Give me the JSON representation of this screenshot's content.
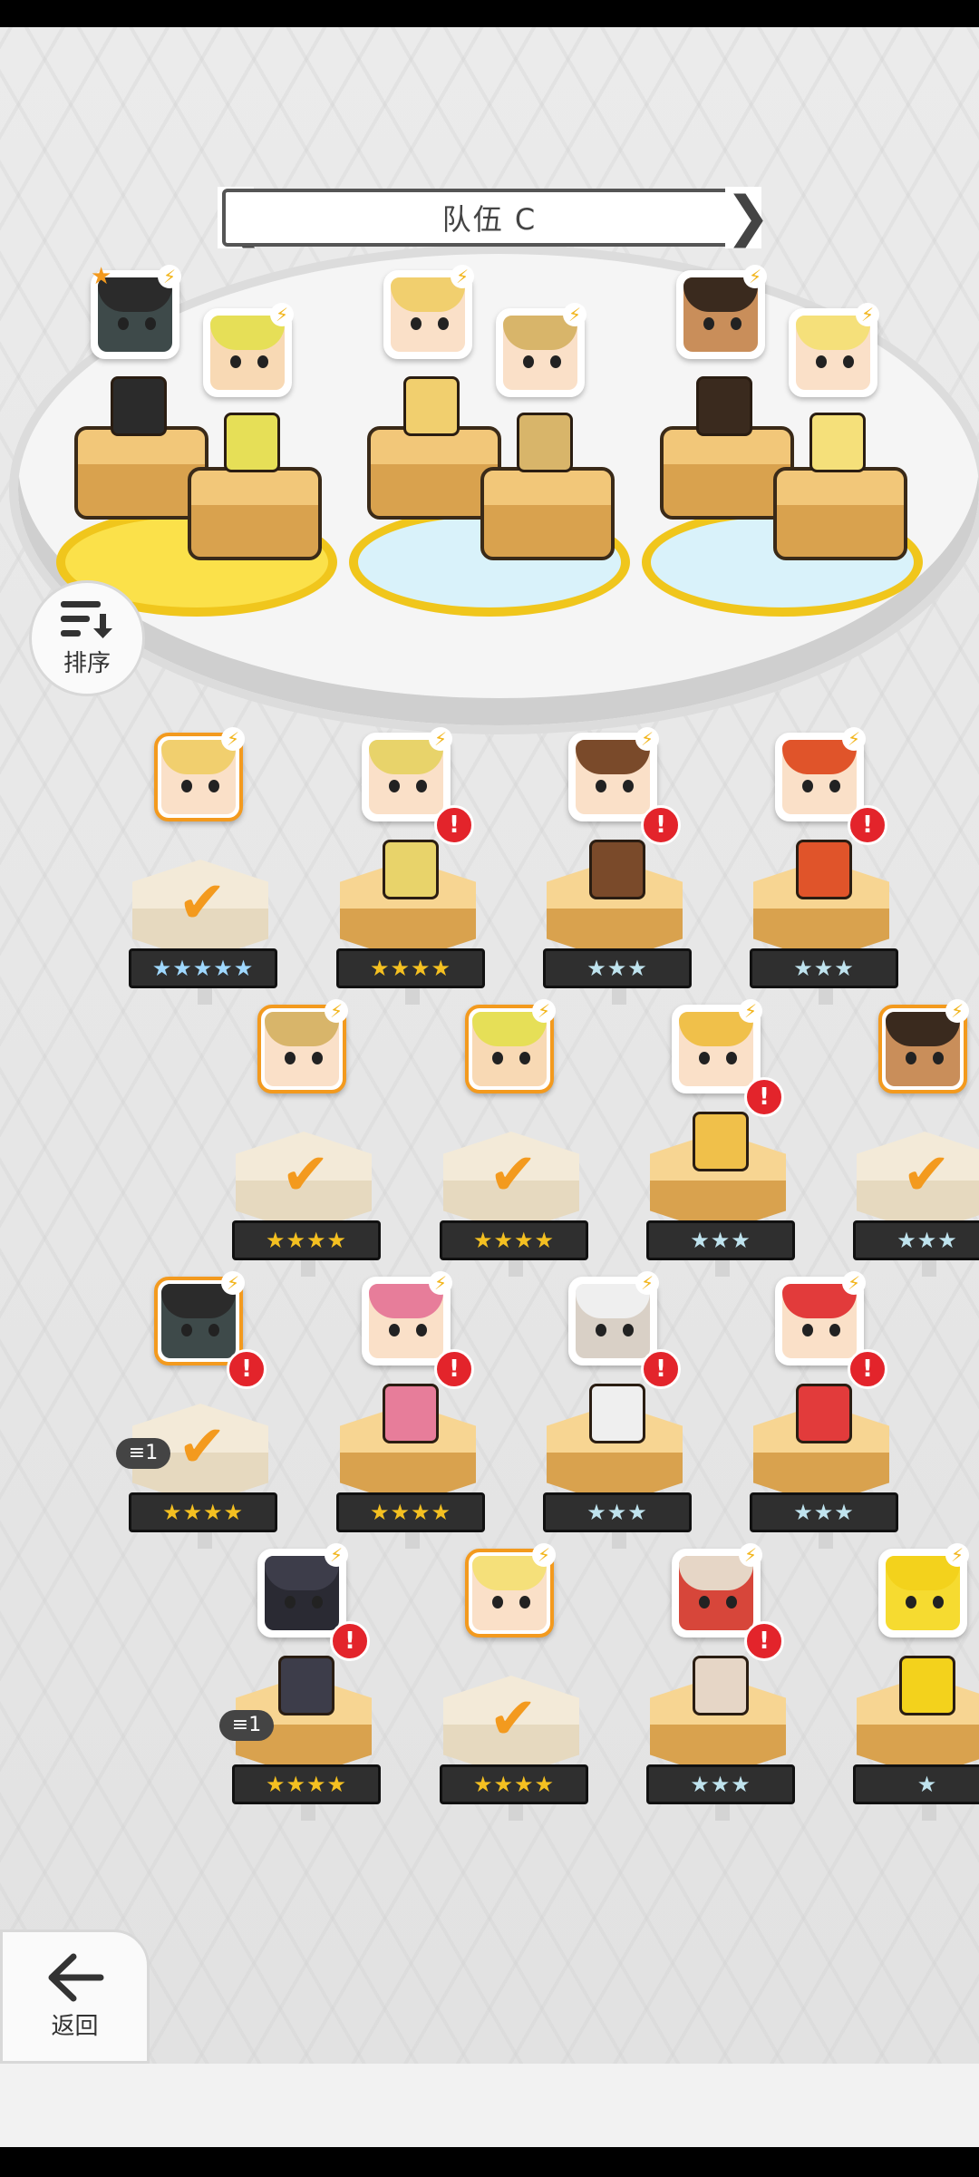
{
  "team": {
    "title": "队伍 C",
    "prev_glyph": "❮",
    "next_glyph": "❯"
  },
  "sort": {
    "label": "排序",
    "icon": "sort-icon"
  },
  "back": {
    "label": "返回",
    "icon": "back-arrow-icon"
  },
  "glyphs": {
    "bolt": "⚡",
    "alert": "!",
    "check": "✔",
    "star": "★"
  },
  "team_slots": [
    {
      "name": "slot-1a",
      "hair": "#2b2b2b",
      "face": "#3e4a4a",
      "leader": true
    },
    {
      "name": "slot-1b",
      "hair": "#e6df57",
      "face": "#f8d9b4",
      "leader": false
    },
    {
      "name": "slot-2a",
      "hair": "#f1cf6e",
      "face": "#fae0c8",
      "leader": false
    },
    {
      "name": "slot-2b",
      "hair": "#d8b56a",
      "face": "#fae0c8",
      "leader": false
    },
    {
      "name": "slot-3a",
      "hair": "#3a2a1e",
      "face": "#c98e5a",
      "leader": false
    },
    {
      "name": "slot-3b",
      "hair": "#f5e07a",
      "face": "#fae0c8",
      "leader": false
    }
  ],
  "roster": [
    {
      "row": 0,
      "col": 0,
      "hair": "#f1cf6e",
      "face": "#fae0c8",
      "stars": "★★★★★",
      "tier": "rainbow",
      "selected": true,
      "checked": true,
      "alert": false
    },
    {
      "row": 0,
      "col": 1,
      "hair": "#e8d36a",
      "face": "#fae0c8",
      "stars": "★★★★",
      "tier": "gold",
      "selected": false,
      "checked": false,
      "alert": true
    },
    {
      "row": 0,
      "col": 2,
      "hair": "#7a4a2a",
      "face": "#fae0c8",
      "stars": "★★★",
      "tier": "silver",
      "selected": false,
      "checked": false,
      "alert": true
    },
    {
      "row": 0,
      "col": 3,
      "hair": "#e0542a",
      "face": "#fae0c8",
      "stars": "★★★",
      "tier": "silver",
      "selected": false,
      "checked": false,
      "alert": true
    },
    {
      "row": 1,
      "col": 0,
      "hair": "#d8b56a",
      "face": "#fae0c8",
      "stars": "★★★★",
      "tier": "gold",
      "selected": true,
      "checked": true,
      "alert": false
    },
    {
      "row": 1,
      "col": 1,
      "hair": "#e6df57",
      "face": "#f8d9b4",
      "stars": "★★★★",
      "tier": "gold",
      "selected": true,
      "checked": true,
      "alert": false
    },
    {
      "row": 1,
      "col": 2,
      "hair": "#f0c04a",
      "face": "#fae0c8",
      "stars": "★★★",
      "tier": "silver",
      "selected": false,
      "checked": false,
      "alert": true
    },
    {
      "row": 1,
      "col": 3,
      "hair": "#3a2a1e",
      "face": "#c98e5a",
      "stars": "★★★",
      "tier": "silver",
      "selected": true,
      "checked": true,
      "alert": false
    },
    {
      "row": 2,
      "col": 0,
      "hair": "#2b2b2b",
      "face": "#3e4a4a",
      "stars": "★★★★",
      "tier": "gold",
      "selected": true,
      "checked": true,
      "alert": true,
      "chip": "1"
    },
    {
      "row": 2,
      "col": 1,
      "hair": "#e77d9a",
      "face": "#fae0c8",
      "stars": "★★★★",
      "tier": "gold",
      "selected": false,
      "checked": false,
      "alert": true
    },
    {
      "row": 2,
      "col": 2,
      "hair": "#efefef",
      "face": "#d9d0c6",
      "stars": "★★★",
      "tier": "silver",
      "selected": false,
      "checked": false,
      "alert": true
    },
    {
      "row": 2,
      "col": 3,
      "hair": "#e23b3b",
      "face": "#fae0c8",
      "stars": "★★★",
      "tier": "silver",
      "selected": false,
      "checked": false,
      "alert": true
    },
    {
      "row": 3,
      "col": 0,
      "hair": "#3d3d4a",
      "face": "#2a2a33",
      "stars": "★★★★",
      "tier": "gold",
      "selected": false,
      "checked": false,
      "alert": true,
      "chip": "1"
    },
    {
      "row": 3,
      "col": 1,
      "hair": "#f5e07a",
      "face": "#fae0c8",
      "stars": "★★★★",
      "tier": "gold",
      "selected": true,
      "checked": true,
      "alert": false
    },
    {
      "row": 3,
      "col": 2,
      "hair": "#e6d6c6",
      "face": "#d7463a",
      "stars": "★★★",
      "tier": "silver",
      "selected": false,
      "checked": false,
      "alert": true
    },
    {
      "row": 3,
      "col": 3,
      "hair": "#f3d21c",
      "face": "#f6db30",
      "stars": "★",
      "tier": "silver",
      "selected": false,
      "checked": false,
      "alert": false
    }
  ]
}
